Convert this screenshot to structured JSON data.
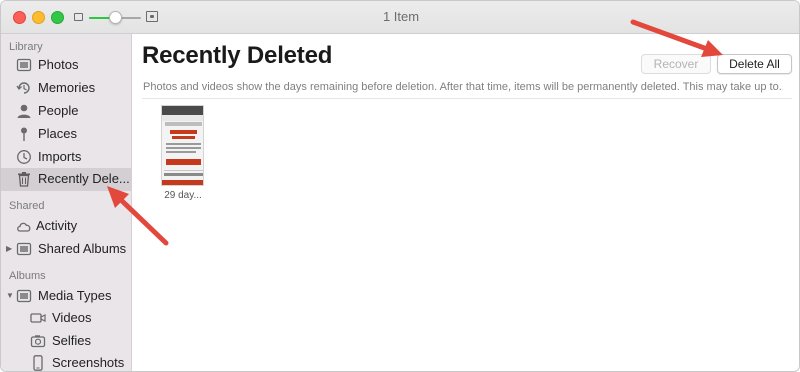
{
  "window": {
    "title": "1 Item"
  },
  "sidebar": {
    "sections": [
      {
        "header": "Library",
        "items": [
          {
            "label": "Photos",
            "icon": "photos-icon"
          },
          {
            "label": "Memories",
            "icon": "memories-icon"
          },
          {
            "label": "People",
            "icon": "people-icon"
          },
          {
            "label": "Places",
            "icon": "places-pin-icon"
          },
          {
            "label": "Imports",
            "icon": "imports-clock-icon"
          },
          {
            "label": "Recently Dele...",
            "icon": "trash-icon",
            "selected": true
          }
        ]
      },
      {
        "header": "Shared",
        "items": [
          {
            "label": "Activity",
            "icon": "cloud-icon"
          },
          {
            "label": "Shared Albums",
            "icon": "shared-albums-icon",
            "disclosure": "collapsed"
          }
        ]
      },
      {
        "header": "Albums",
        "items": [
          {
            "label": "Media Types",
            "icon": "media-types-icon",
            "disclosure": "expanded"
          },
          {
            "label": "Videos",
            "icon": "video-camera-icon"
          },
          {
            "label": "Selfies",
            "icon": "selfie-camera-icon"
          },
          {
            "label": "Screenshots",
            "icon": "screenshot-phone-icon"
          }
        ]
      }
    ]
  },
  "main": {
    "title": "Recently Deleted",
    "recover_label": "Recover",
    "recover_enabled": false,
    "delete_all_label": "Delete All",
    "info_text": "Photos and videos show the days remaining before deletion. After that time, items will be permanently deleted. This may take up to...",
    "items": [
      {
        "caption": "29 day..."
      }
    ]
  },
  "colors": {
    "sidebar_bg": "#e9e5e9",
    "selected_bg": "#d3cfd3",
    "annotation_arrow": "#e2483b",
    "thumbnail_accent": "#c53a1c"
  }
}
